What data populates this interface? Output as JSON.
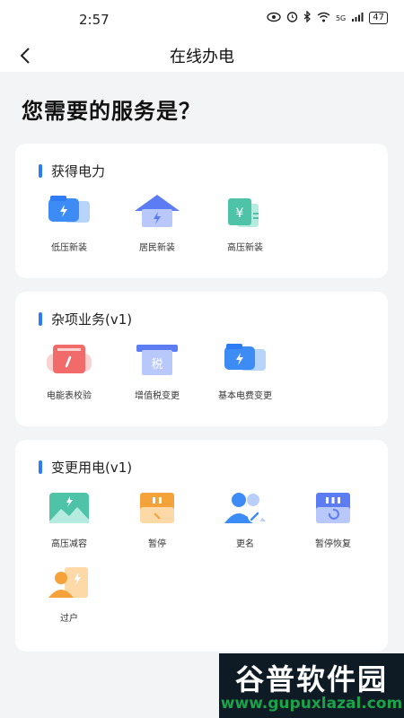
{
  "status": {
    "time": "2:57",
    "signal": "5G",
    "battery": "47"
  },
  "nav": {
    "title": "在线办电"
  },
  "page_title": "您需要的服务是？",
  "sections": [
    {
      "title": "获得电力",
      "items": [
        {
          "label": "低压新装",
          "icon": "wallet-bolt-icon"
        },
        {
          "label": "居民新装",
          "icon": "house-bolt-icon"
        },
        {
          "label": "高压新装",
          "icon": "ticket-icon"
        }
      ]
    },
    {
      "title": "杂项业务(v1)",
      "items": [
        {
          "label": "电能表校验",
          "icon": "meter-check-icon"
        },
        {
          "label": "增值税变更",
          "icon": "tax-icon"
        },
        {
          "label": "基本电费变更",
          "icon": "wallet-bolt-icon"
        }
      ]
    },
    {
      "title": "变更用电(v1)",
      "items": [
        {
          "label": "高压减容",
          "icon": "mountain-bolt-icon"
        },
        {
          "label": "暂停",
          "icon": "pause-box-icon"
        },
        {
          "label": "更名",
          "icon": "users-edit-icon"
        },
        {
          "label": "暂停恢复",
          "icon": "restore-box-icon"
        },
        {
          "label": "过户",
          "icon": "transfer-user-icon"
        }
      ]
    }
  ],
  "watermark": {
    "line1": "谷普软件园",
    "line2": "www.gupuxlazal.com"
  },
  "colors": {
    "accent": "#2d7cf6",
    "background": "#f3f4f6",
    "card": "#ffffff"
  }
}
